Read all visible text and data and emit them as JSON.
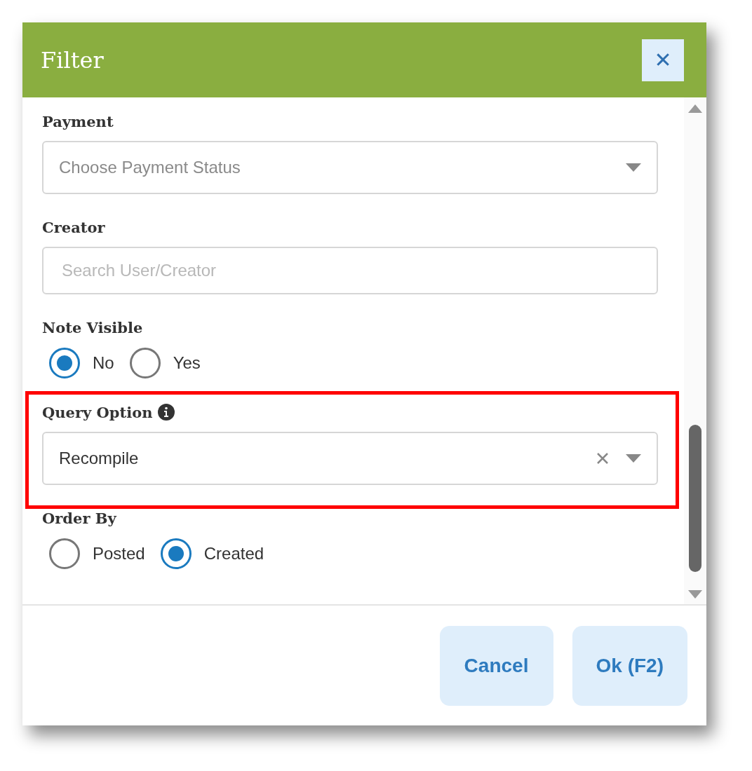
{
  "dialog": {
    "title": "Filter",
    "close_label": "✕"
  },
  "fields": [
    {
      "kind": "select",
      "label": "Payment",
      "placeholder": "Choose Payment Status"
    },
    {
      "kind": "text",
      "label": "Creator",
      "placeholder": "Search User/Creator"
    },
    {
      "kind": "radio",
      "label": "Note Visible",
      "options": [
        {
          "label": "No",
          "selected": true
        },
        {
          "label": "Yes",
          "selected": false
        }
      ]
    },
    {
      "kind": "select",
      "label": "Query Option",
      "info": true,
      "value": "Recompile",
      "clearable": true,
      "highlighted": true
    },
    {
      "kind": "radio",
      "label": "Order By",
      "options": [
        {
          "label": "Posted",
          "selected": false
        },
        {
          "label": "Created",
          "selected": true
        }
      ]
    }
  ],
  "buttons": [
    "Cancel",
    "Ok (F2)"
  ]
}
